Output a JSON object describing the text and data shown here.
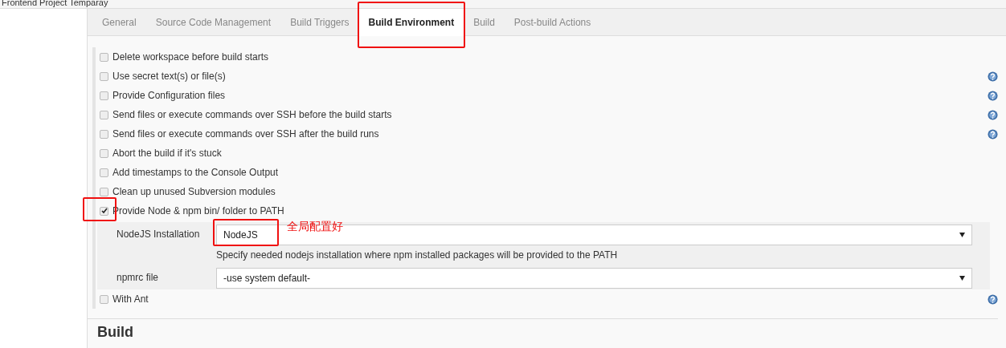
{
  "breadcrumb": {
    "text": "Frontend Project Temparay"
  },
  "tabs": [
    {
      "label": "General",
      "selected": false,
      "highlighted": false
    },
    {
      "label": "Source Code Management",
      "selected": false,
      "highlighted": false
    },
    {
      "label": "Build Triggers",
      "selected": false,
      "highlighted": false
    },
    {
      "label": "Build Environment",
      "selected": true,
      "highlighted": true
    },
    {
      "label": "Build",
      "selected": false,
      "highlighted": false
    },
    {
      "label": "Post-build Actions",
      "selected": false,
      "highlighted": false
    }
  ],
  "options": [
    {
      "label": "Delete workspace before build starts",
      "checked": false,
      "help": false,
      "highlighted": false
    },
    {
      "label": "Use secret text(s) or file(s)",
      "checked": false,
      "help": true,
      "highlighted": false
    },
    {
      "label": "Provide Configuration files",
      "checked": false,
      "help": true,
      "highlighted": false
    },
    {
      "label": "Send files or execute commands over SSH before the build starts",
      "checked": false,
      "help": true,
      "highlighted": false
    },
    {
      "label": "Send files or execute commands over SSH after the build runs",
      "checked": false,
      "help": true,
      "highlighted": false
    },
    {
      "label": "Abort the build if it's stuck",
      "checked": false,
      "help": false,
      "highlighted": false
    },
    {
      "label": "Add timestamps to the Console Output",
      "checked": false,
      "help": false,
      "highlighted": false
    },
    {
      "label": "Clean up unused Subversion modules",
      "checked": false,
      "help": false,
      "highlighted": false
    },
    {
      "label": "Provide Node & npm bin/ folder to PATH",
      "checked": true,
      "help": false,
      "highlighted": true,
      "fields": [
        {
          "label": "NodeJS Installation",
          "value": "NodeJS",
          "description": "Specify needed nodejs installation where npm installed packages will be provided to the PATH",
          "highlighted": true,
          "note": "全局配置好"
        },
        {
          "label": "npmrc file",
          "value": "-use system default-",
          "highlighted": false
        }
      ]
    },
    {
      "label": "With Ant",
      "checked": false,
      "help": true,
      "highlighted": false
    }
  ],
  "next_section": {
    "title": "Build"
  }
}
